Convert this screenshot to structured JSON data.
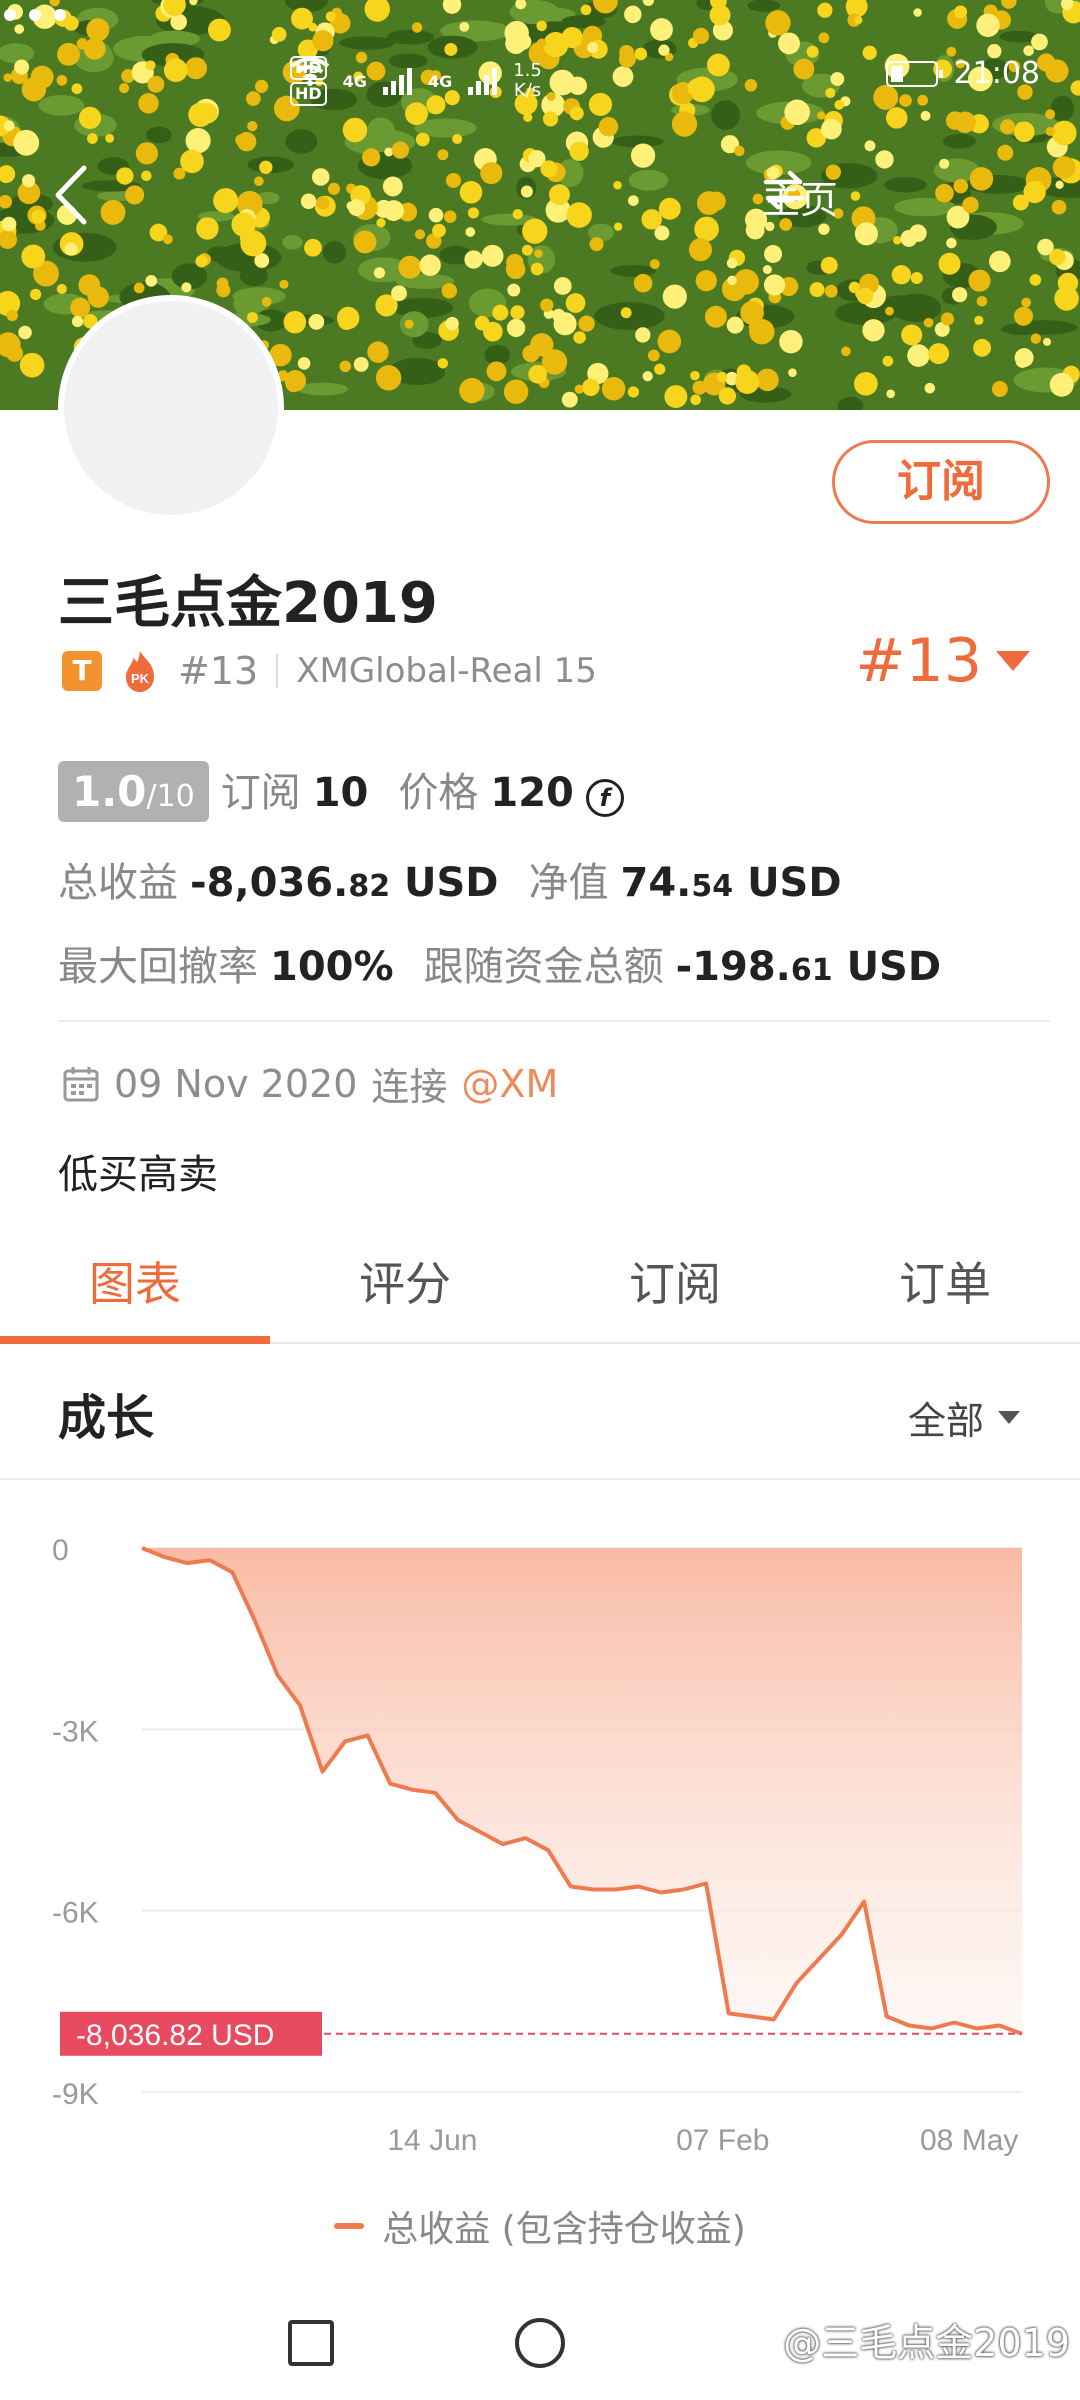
{
  "status_bar": {
    "network_1": "HD",
    "network_2": "HD",
    "gen_1": "4G",
    "gen_2": "4G",
    "speed_value": "1.5",
    "speed_unit": "K/s",
    "time": "21:08"
  },
  "header": {
    "home_label": "主页"
  },
  "profile": {
    "subscribe_label": "订阅",
    "name": "三毛点金2019",
    "badge_t": "T",
    "badge_pk": "PK",
    "rank_small": "#13",
    "server": "XMGlobal-Real 15",
    "rank_big": "#13"
  },
  "stats": {
    "score_main": "1.0",
    "score_total": "/10",
    "subscribe_label": "订阅",
    "subscribe_count": "10",
    "price_label": "价格",
    "price_value": "120",
    "coin_symbol": "f",
    "total_profit_label": "总收益",
    "total_profit_int": "-8,036.",
    "total_profit_dec": "82",
    "total_profit_unit": "USD",
    "net_value_label": "净值",
    "net_value_int": "74.",
    "net_value_dec": "54",
    "net_value_unit": "USD",
    "max_drawdown_label": "最大回撤率",
    "max_drawdown_value": "100%",
    "follow_funds_label": "跟随资金总额",
    "follow_funds_int": "-198.",
    "follow_funds_dec": "61",
    "follow_funds_unit": "USD"
  },
  "connection": {
    "date": "09 Nov 2020",
    "connect_label": "连接",
    "broker": "@XM",
    "description": "低买高卖"
  },
  "tabs": [
    {
      "label": "图表",
      "active": true
    },
    {
      "label": "评分",
      "active": false
    },
    {
      "label": "订阅",
      "active": false
    },
    {
      "label": "订单",
      "active": false
    }
  ],
  "growth": {
    "title": "成长",
    "range": "全部"
  },
  "chart_data": {
    "type": "area",
    "title": "",
    "xlabel": "",
    "ylabel": "",
    "ylim": [
      -9000,
      0
    ],
    "yticks": [
      "0",
      "-3K",
      "-6K",
      "-9K"
    ],
    "xticks": [
      "14 Jun",
      "07 Feb",
      "08 May"
    ],
    "current_value_label": "-8,036.82 USD",
    "current_value": -8036.82,
    "series": [
      {
        "name": "总收益 (包含持仓收益)",
        "values": [
          0,
          -150,
          -250,
          -200,
          -400,
          -1200,
          -2100,
          -2600,
          -3700,
          -3200,
          -3100,
          -3900,
          -4000,
          -4050,
          -4500,
          -4700,
          -4900,
          -4800,
          -5000,
          -5600,
          -5650,
          -5650,
          -5600,
          -5700,
          -5650,
          -5550,
          -7700,
          -7750,
          -7800,
          -7200,
          -6800,
          -6400,
          -5850,
          -7750,
          -7900,
          -7950,
          -7850,
          -7950,
          -7900,
          -8036.82
        ]
      }
    ],
    "colors": {
      "line": "#ef7a4e",
      "fill_top": "#f9b7a0",
      "marker": "#e84a5f"
    }
  },
  "legend": {
    "label": "总收益 (包含持仓收益)"
  },
  "watermark": "@三毛点金2019"
}
